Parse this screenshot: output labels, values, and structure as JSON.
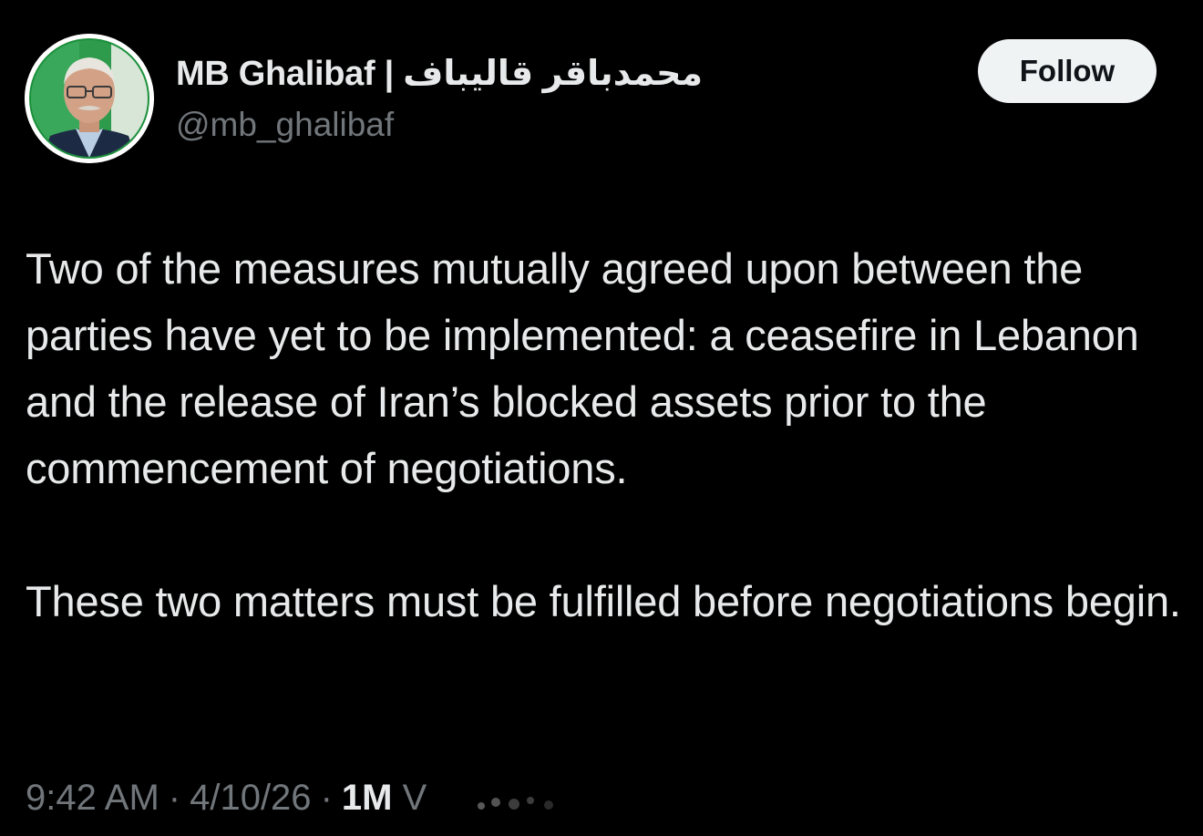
{
  "author": {
    "display_name": "MB Ghalibaf | محمدباقر قالیباف",
    "handle": "@mb_ghalibaf",
    "avatar_icon": "profile-photo"
  },
  "actions": {
    "follow_label": "Follow"
  },
  "tweet": {
    "paragraphs": [
      "Two of the measures mutually agreed upon between the parties have yet to be implemented: a ceasefire in Lebanon and the release of Iran’s blocked assets prior to the commencement of negotiations.",
      "These two matters must be fulfilled before negotiations begin."
    ]
  },
  "meta": {
    "time": "9:42 AM",
    "separator": "·",
    "date": "4/10/26",
    "views_count": "1M",
    "views_label_partial": "V"
  },
  "colors": {
    "background": "#000000",
    "primary_text": "#e7e9ea",
    "secondary_text": "#71767b",
    "follow_bg": "#eff3f4",
    "follow_text": "#0f1419",
    "avatar_ring": "#1a8f3a"
  }
}
